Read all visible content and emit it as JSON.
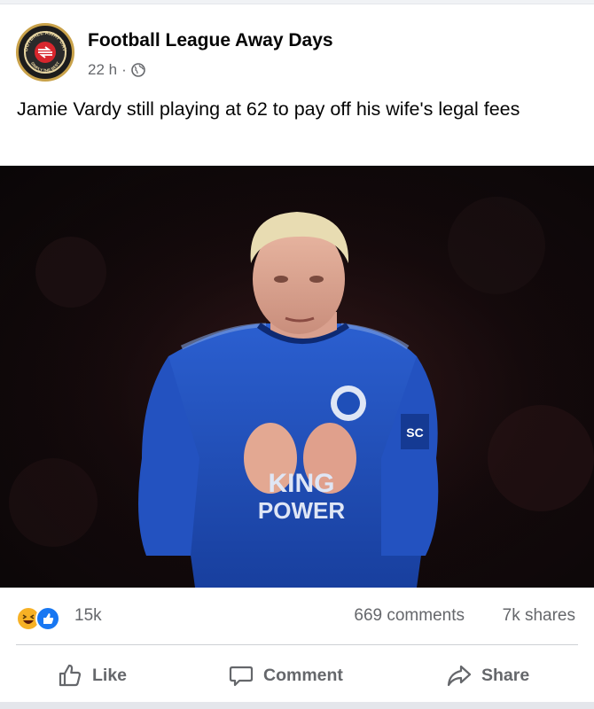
{
  "post": {
    "page_name": "Football League Away Days",
    "time": "22 h",
    "separator": "·",
    "audience_icon": "globe-icon",
    "text": "Jamie Vardy still playing at 62 to pay off his wife's legal fees"
  },
  "avatar": {
    "logo_text_top": "FOOTBALL AWAY DAYS",
    "logo_text_bottom": "SIMPLY THE BEST"
  },
  "photo": {
    "shirt_text_line1": "KING",
    "shirt_text_line2": "POWER",
    "sleeve_text": "SC"
  },
  "reactions": {
    "icons": [
      "haha-icon",
      "like-icon"
    ],
    "count": "15k",
    "comments": "669 comments",
    "shares": "7k shares"
  },
  "actions": {
    "like": "Like",
    "comment": "Comment",
    "share": "Share"
  },
  "colors": {
    "shirt_blue": "#1f4fb8",
    "text_primary": "#050505",
    "text_secondary": "#65676b",
    "like_blue": "#1877f2",
    "haha_yellow": "#f7b125"
  }
}
